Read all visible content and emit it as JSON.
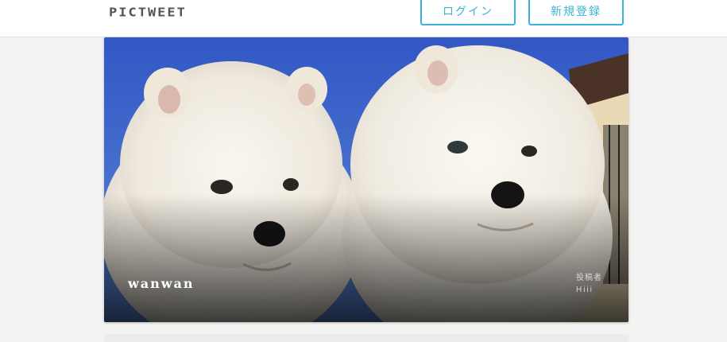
{
  "header": {
    "logo": "Pictweet",
    "login_label": "ログイン",
    "signup_label": "新規登録"
  },
  "card": {
    "title": "wanwan",
    "poster_label": "投稿者",
    "poster_name": "Hiii",
    "image_subject": "two-white-fluffy-puppies"
  },
  "colors": {
    "accent": "#3bb3d6",
    "background": "#f3f3f2",
    "sky": "#3c66c8"
  }
}
